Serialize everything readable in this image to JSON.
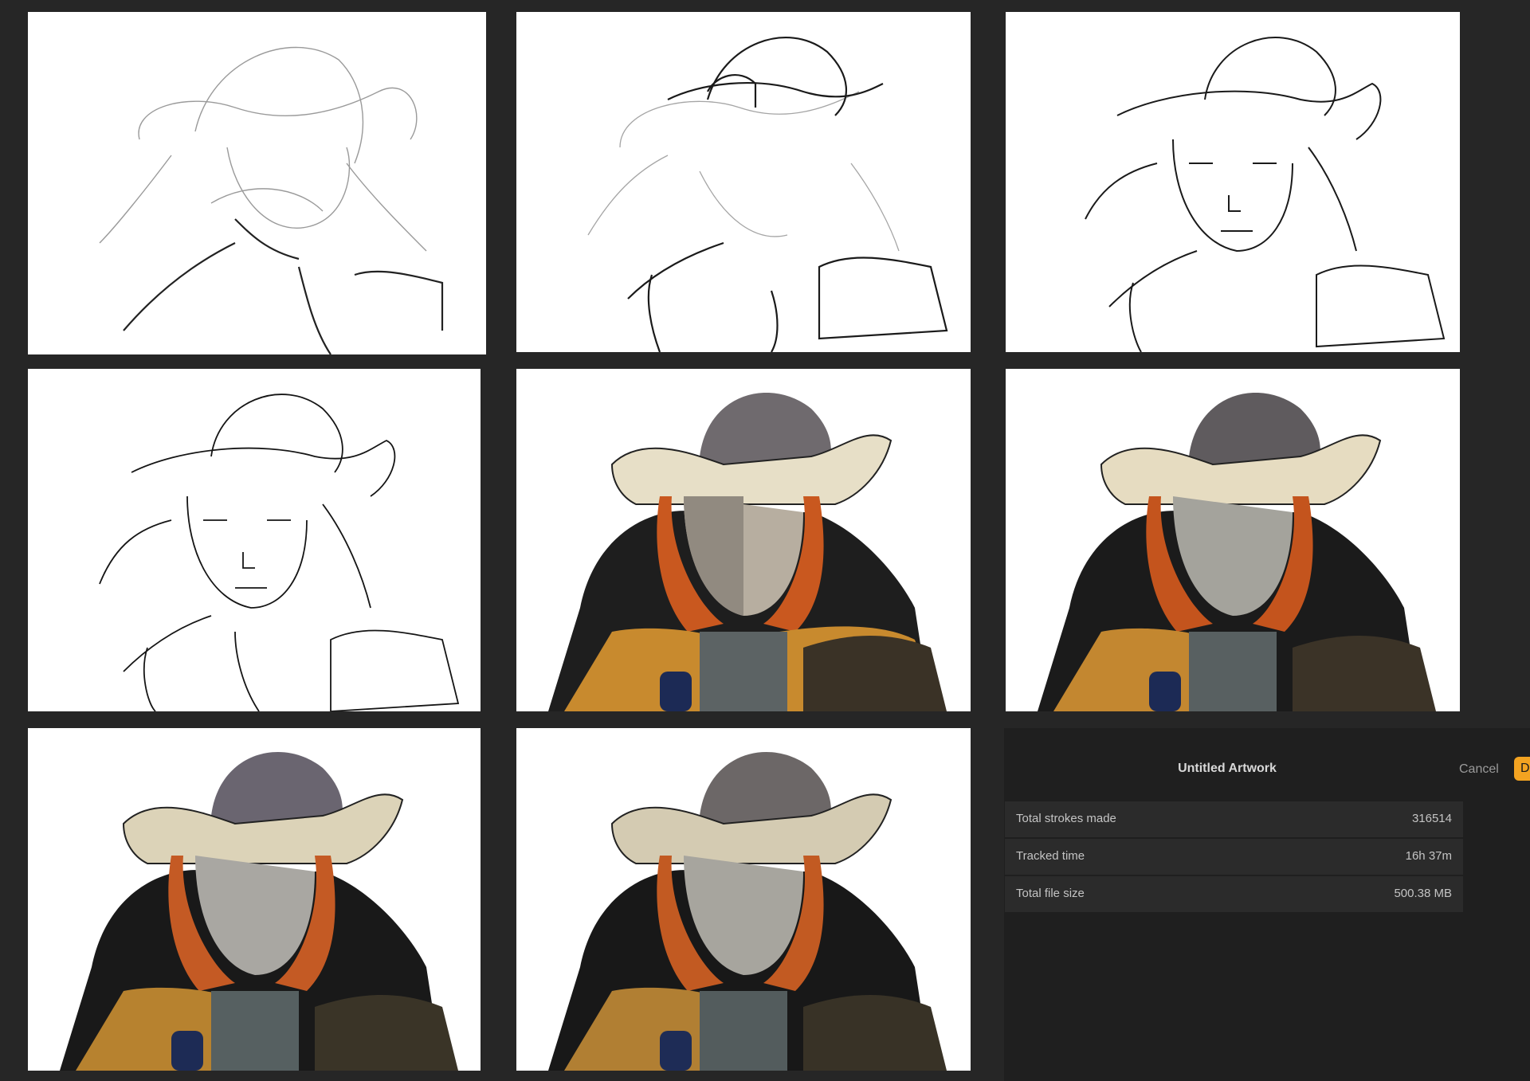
{
  "export_panel": {
    "title": "Untitled Artwork",
    "cancel_label": "Cancel",
    "done_label": "D",
    "accent_color": "#f3a321",
    "stats": [
      {
        "label": "Total strokes made",
        "value": "316514"
      },
      {
        "label": "Tracked time",
        "value": "16h 37m"
      },
      {
        "label": "Total file size",
        "value": "500.38 MB"
      }
    ]
  },
  "gallery": {
    "frames": [
      {
        "stage": "rough-sketch"
      },
      {
        "stage": "refined-sketch"
      },
      {
        "stage": "line-sketch"
      },
      {
        "stage": "line-art"
      },
      {
        "stage": "flat-color"
      },
      {
        "stage": "shading"
      },
      {
        "stage": "rendering"
      },
      {
        "stage": "final-render"
      }
    ]
  }
}
